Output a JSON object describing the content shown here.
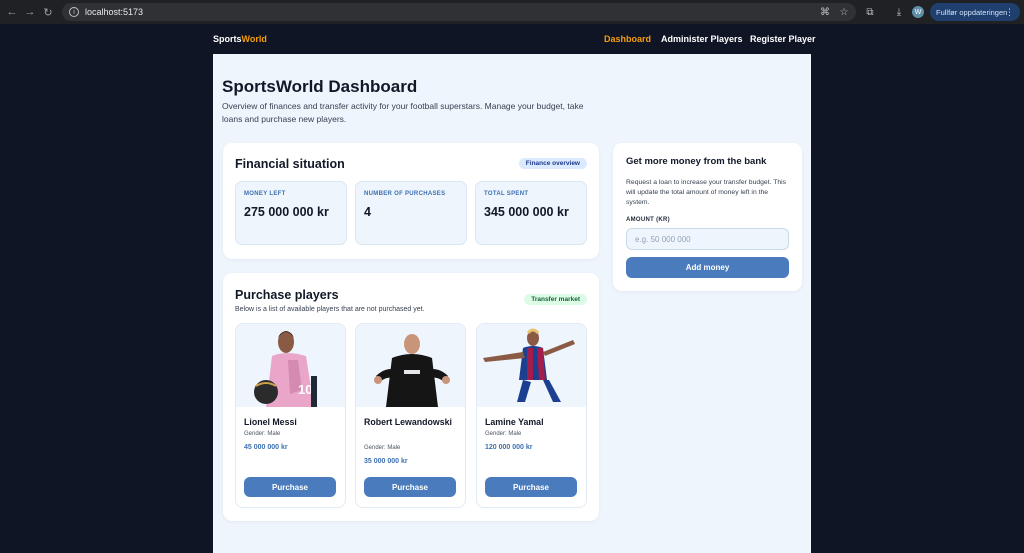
{
  "browser": {
    "url": "localhost:5173",
    "update_label": "Fullfør oppdateringen",
    "profile_initial": "W"
  },
  "navbar": {
    "logo_part1": "Sports",
    "logo_part2": "World",
    "links": [
      "Dashboard",
      "Administer Players",
      "Register Player"
    ],
    "active": "Dashboard",
    "accent_color": "#f59e0b"
  },
  "header": {
    "title": "SportsWorld Dashboard",
    "subtitle": "Overview of finances and transfer activity for your football superstars. Manage your budget, take loans and purchase new players."
  },
  "finance": {
    "title": "Financial situation",
    "badge": "Finance overview",
    "stats": [
      {
        "label": "MONEY LEFT",
        "value": "275 000 000 kr"
      },
      {
        "label": "NUMBER OF PURCHASES",
        "value": "4"
      },
      {
        "label": "TOTAL SPENT",
        "value": "345 000 000 kr"
      }
    ]
  },
  "bank": {
    "title": "Get more money from the bank",
    "description": "Request a loan to increase your transfer budget. This will update the total amount of money left in the system.",
    "field_label": "AMOUNT (KR)",
    "placeholder": "e.g. 50 000 000",
    "button": "Add money"
  },
  "purchase": {
    "title": "Purchase players",
    "subtitle": "Below is a list of available players that are not purchased yet.",
    "badge": "Transfer market",
    "players": [
      {
        "name": "Lionel Messi",
        "gender": "Gender: Male",
        "price": "45 000 000 kr",
        "button": "Purchase"
      },
      {
        "name": "Robert Lewandowski",
        "gender": "Gender: Male",
        "price": "35 000 000 kr",
        "button": "Purchase"
      },
      {
        "name": "Lamine Yamal",
        "gender": "Gender: Male",
        "price": "120 000 000 kr",
        "button": "Purchase"
      }
    ]
  },
  "colors": {
    "primary_button": "#4a7bbd",
    "page_bg": "#eef5fd",
    "dark_bg": "#0f1524"
  }
}
